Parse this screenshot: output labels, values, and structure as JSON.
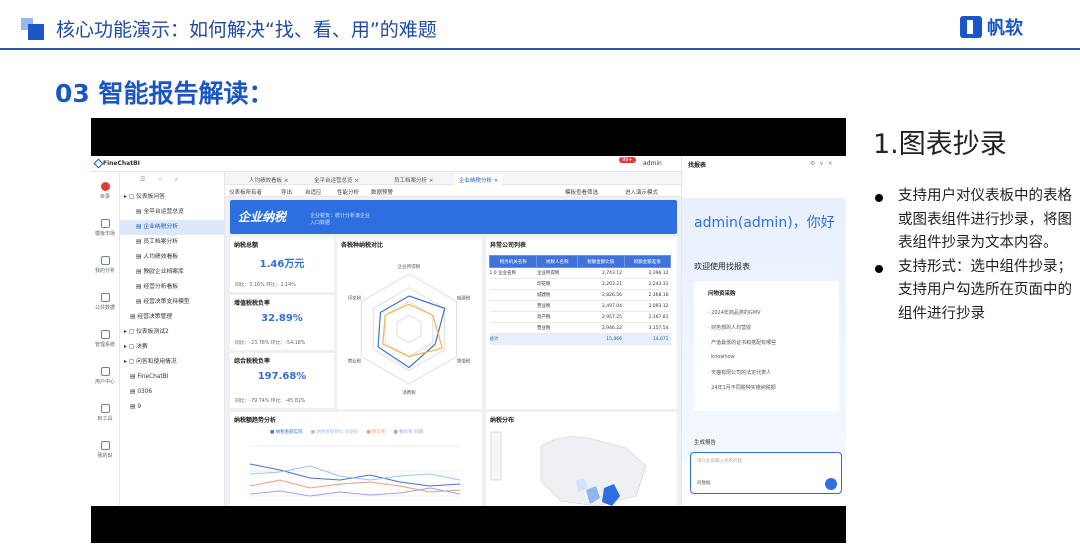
{
  "slide": {
    "title": "核心功能演示：如何解决“找、看、用”的难题",
    "logo_text": "帆软",
    "section_title": "03 智能报告解读：",
    "accent_color": "#1a56c6"
  },
  "app": {
    "name": "FineChatBI",
    "notice_count": "99+",
    "user": "admin",
    "left_nav": [
      "目录",
      "模板市场",
      "我的分析",
      "公共数据",
      "管理系统",
      "用户中心",
      "BI工具",
      "我的BI"
    ],
    "tree_items": [
      "仪表板问答",
      "全平台运营总览",
      "企业纳税分析",
      "员工档案分析",
      "人均绩效看板",
      "教欧企业档案库",
      "经营分析看板",
      "经营决策支持模型",
      "经营决策管理",
      "仪表板测试2",
      "决赛",
      "问答和使用情况",
      "FineChatBI",
      "0306",
      "9"
    ],
    "tabs": [
      "人均绩效看板",
      "全平台运营总览",
      "员工档案分析",
      "企业纳税分析"
    ],
    "toolbar": [
      "仪表板所有者",
      "导出",
      "自适应",
      "性能分析",
      "数据预警",
      "模板查看筛选",
      "进入演示模式"
    ],
    "banner_title": "企业纳税",
    "banner_sub": "企业税负：统计分析该企业入口数据",
    "kpis": [
      {
        "title": "纳税总额",
        "value": "1.46万元",
        "m1": "同比：3.16%",
        "m2": "环比：2.14%"
      },
      {
        "title": "增值税税负率",
        "value": "32.89%",
        "m1": "同比：-23.78%",
        "m2": "环比：-54.18%"
      },
      {
        "title": "综合税税负率",
        "value": "197.68%",
        "m1": "同比：-79.74%",
        "m2": "环比：-45.81%"
      }
    ],
    "radar_title": "各税种纳税对比",
    "radar_labels": [
      "企业所得税",
      "城建税",
      "增值税",
      "消费税",
      "营业税",
      "印花税"
    ],
    "table_title": "异常公司列表",
    "table_headers": [
      "税务机关名称",
      "纳税人名称",
      "税额金额比值",
      "税额金额差值"
    ],
    "table_rows": [
      [
        "1.0 企业名称",
        "企业所得税",
        "2,743.12",
        "2,396.12"
      ],
      [
        "",
        "印花税",
        "2,203.21",
        "2,243.31"
      ],
      [
        "",
        "城建税",
        "2,826.56",
        "2,368.16"
      ],
      [
        "",
        "营业税",
        "2,497.04",
        "2,093.12"
      ],
      [
        "",
        "资产税",
        "2,957.25",
        "2,367.81"
      ],
      [
        "",
        "营业税",
        "2,946.22",
        "3,157.54"
      ]
    ],
    "table_total": [
      "总计",
      "",
      "15,066",
      "14,671"
    ],
    "trend_title": "纳税额趋势分析",
    "trend_legend": [
      "纳税金额实际",
      "纳税金额目标 同期值",
      "税负率",
      "税负率 同期"
    ],
    "map_title": "纳税分布",
    "side_title": "找报表",
    "side_greeting": "admin(admin)，你好",
    "side_welcome": "欢迎使用找报表",
    "side_box_title": "问物资采购",
    "side_questions": [
      "2024年商品类的GMV",
      "财务部的人均营收",
      "产值最低的证书和搭配有哪些",
      "knowhow",
      "天猫有限公司的法定代表人",
      "24年1月不同税种实缴纳税额"
    ],
    "side_generate": "生成报告",
    "side_placeholder": "请在此处输入你的问题",
    "side_ask": "问数据"
  },
  "description": {
    "heading": "1.图表抄录",
    "bullets": [
      "支持用户对仪表板中的表格或图表组件进行抄录，将图表组件抄录为文本内容。",
      "支持形式：选中组件抄录；支持用户勾选所在页面中的组件进行抄录"
    ]
  }
}
